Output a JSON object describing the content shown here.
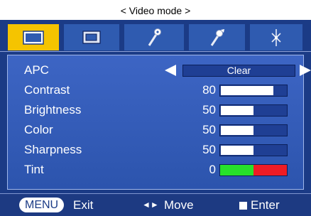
{
  "header": {
    "title": "< Video mode >"
  },
  "tabs": [
    {
      "name": "video",
      "icon": "tv-screen-icon",
      "active": true
    },
    {
      "name": "screen",
      "icon": "picture-in-picture-icon",
      "active": false
    },
    {
      "name": "tools",
      "icon": "tool-icon",
      "active": false
    },
    {
      "name": "settings",
      "icon": "tools-icon",
      "active": false
    },
    {
      "name": "network",
      "icon": "network-icon",
      "active": false
    }
  ],
  "menu": {
    "apc": {
      "label": "APC",
      "value": "Clear"
    },
    "items": [
      {
        "label": "Contrast",
        "value": "80",
        "level": 0.8
      },
      {
        "label": "Brightness",
        "value": "50",
        "level": 0.5
      },
      {
        "label": "Color",
        "value": "50",
        "level": 0.5
      },
      {
        "label": "Sharpness",
        "value": "50",
        "level": 0.5
      }
    ],
    "tint": {
      "label": "Tint",
      "value": "0",
      "colors": [
        "#27e12a",
        "#ee1c24"
      ]
    }
  },
  "footer": {
    "menu_key": "MENU",
    "exit_label": "Exit",
    "move_label": "Move",
    "move_icon": "◄►",
    "enter_label": "Enter"
  },
  "colors": {
    "background": "#1b3b86",
    "active_tab": "#f5c400",
    "panel": "#3d65c4"
  }
}
